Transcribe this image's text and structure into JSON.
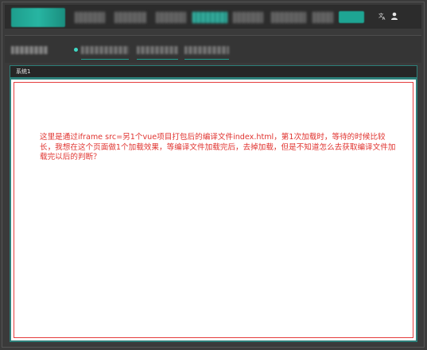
{
  "header": {
    "nav_items": [
      "",
      "",
      "",
      "",
      "",
      "",
      ""
    ],
    "language_icon": "translate-icon",
    "user_icon": "user-icon"
  },
  "subheader": {
    "title": "",
    "tabs": [
      "",
      "",
      ""
    ]
  },
  "system_bar": {
    "label": "系统1"
  },
  "content": {
    "message": "这里是通过iframe src=另1个vue项目打包后的编译文件index.html，第1次加载时，等待的时候比较长，我想在这个页面做1个加载效果，等编译文件加载完后，去掉加载，但是不知道怎么去获取编译文件加载完以后的判断？"
  },
  "colors": {
    "accent": "#1ea593",
    "border": "#2c7f79",
    "annotation": "#e43b3b"
  }
}
